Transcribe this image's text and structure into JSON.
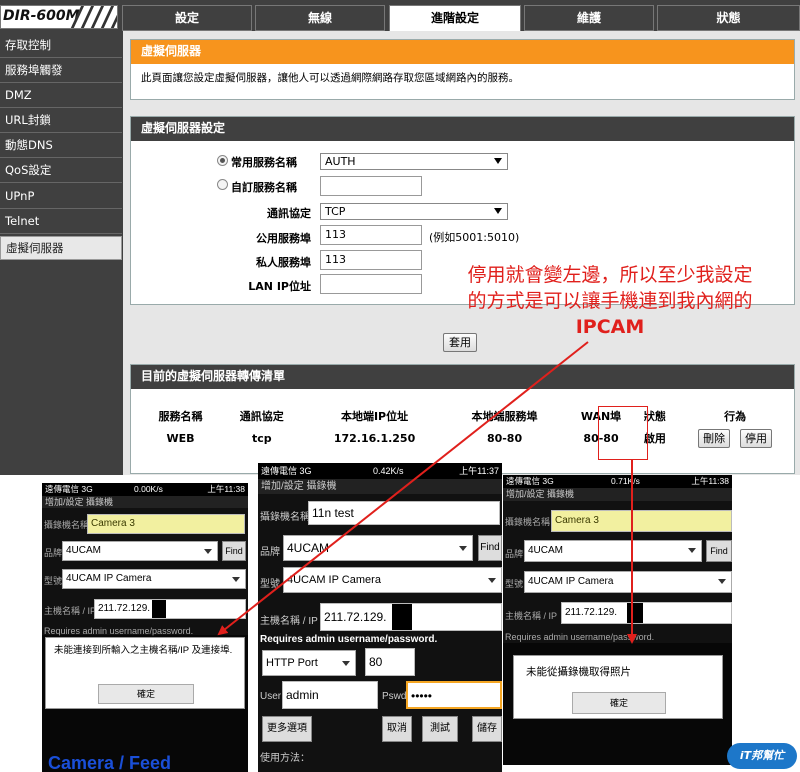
{
  "router": {
    "logo": "DIR-600M",
    "top_tabs": [
      "設定",
      "無線",
      "進階設定",
      "維護",
      "狀態"
    ],
    "active_tab": 2,
    "sidebar": [
      "存取控制",
      "服務埠觸發",
      "DMZ",
      "URL封鎖",
      "動態DNS",
      "QoS設定",
      "UPnP",
      "Telnet",
      "虛擬伺服器"
    ],
    "active_sidebar": 8,
    "intro": {
      "title": "虛擬伺服器",
      "description": "此頁面讓您設定虛擬伺服器，讓他人可以透過網際網路存取您區域網路內的服務。"
    },
    "settings": {
      "title": "虛擬伺服器設定",
      "common_service_label": "常用服務名稱",
      "common_service_value": "AUTH",
      "custom_service_label": "自訂服務名稱",
      "protocol_label": "通訊協定",
      "protocol_value": "TCP",
      "public_port_label": "公用服務埠",
      "public_port_value": "113",
      "public_port_hint": "(例如5001:5010)",
      "private_port_label": "私人服務埠",
      "private_port_value": "113",
      "lan_ip_label": "LAN IP位址",
      "apply_label": "套用"
    },
    "list": {
      "title": "目前的虛擬伺服器轉傳清單",
      "headers": [
        "服務名稱",
        "通訊協定",
        "本地端IP位址",
        "本地端服務埠",
        "WAN埠",
        "狀態",
        "行為"
      ],
      "row": {
        "service": "WEB",
        "protocol": "tcp",
        "local_ip": "172.16.1.250",
        "local_port": "80-80",
        "wan_port": "80-80",
        "status": "啟用",
        "delete_label": "刪除",
        "disable_label": "停用"
      }
    }
  },
  "annotation": {
    "line1": "停用就會變左邊，所以至少我設定",
    "line2": "的方式是可以讓手機連到我內網的",
    "line3": "IPCAM",
    "color": "#e0201c"
  },
  "phone_left": {
    "carrier": "遠傳電信 3G",
    "speed": "0.00K/s",
    "time": "上午11:38",
    "title": "增加/設定 攝錄機",
    "camera_name_label": "攝錄機名稱",
    "camera_name": "Camera 3",
    "brand_label": "品牌",
    "brand": "4UCAM",
    "find_label": "Find",
    "model_label": "型號",
    "model": "4UCAM IP Camera",
    "host_label": "主機名稱 / IP",
    "host": "211.72.129.",
    "requires": "Requires admin username/password.",
    "dialog_message": "未能連接到所輸入之主機名稱/IP 及連接埠.",
    "dialog_ok": "確定",
    "bottom_text": "Camera / Feed"
  },
  "phone_middle": {
    "carrier": "遠傳電信 3G",
    "speed": "0.42K/s",
    "time": "上午11:37",
    "title": "增加/設定 攝錄機",
    "camera_name_label": "攝錄機名稱",
    "camera_name": "11n test",
    "brand_label": "品牌",
    "brand": "4UCAM",
    "find_label": "Find",
    "model_label": "型號",
    "model": "4UCAM IP Camera",
    "host_label": "主機名稱 / IP",
    "host": "211.72.129.",
    "requires": "Requires admin username/password.",
    "port_type": "HTTP Port",
    "port_value": "80",
    "user_label": "User",
    "user_value": "admin",
    "pswd_label": "Pswd",
    "pswd_value": "•••••",
    "more_label": "更多選項",
    "cancel_label": "取消",
    "test_label": "測試",
    "save_label": "儲存",
    "usage_label": "使用方法："
  },
  "phone_right": {
    "carrier": "遠傳電信 3G",
    "speed": "0.71K/s",
    "time": "上午11:38",
    "title": "增加/設定 攝錄機",
    "camera_name_label": "攝錄機名稱",
    "camera_name": "Camera 3",
    "brand_label": "品牌",
    "brand": "4UCAM",
    "find_label": "Find",
    "model_label": "型號",
    "model": "4UCAM IP Camera",
    "host_label": "主機名稱 / IP",
    "host": "211.72.129.",
    "requires": "Requires admin username/password.",
    "dialog_message": "未能從攝錄機取得照片",
    "dialog_ok": "確定"
  },
  "watermark": "iT邦幫忙",
  "icons": [
    "radio-selected-icon",
    "radio-unselected-icon",
    "dropdown-arrow-icon",
    "red-arrow-icon",
    "signal-icon",
    "battery-icon"
  ]
}
